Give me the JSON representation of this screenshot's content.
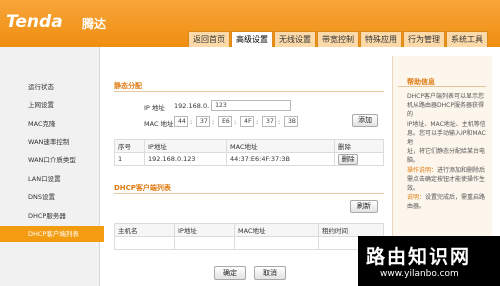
{
  "brand": {
    "logo": "Tenda",
    "logo_cn": "腾达"
  },
  "nav_tabs": [
    "返回首页",
    "高级设置",
    "无线设置",
    "带宽控制",
    "特殊应用",
    "行为管理",
    "系统工具"
  ],
  "sidebar": {
    "items": [
      "运行状态",
      "上网设置",
      "MAC克隆",
      "WAN速率控制",
      "WAN口介质类型",
      "LAN口设置",
      "DNS设置",
      "DHCP服务器",
      "DHCP客户端列表"
    ],
    "active_index": 8
  },
  "static_alloc": {
    "title": "静态分配",
    "ip_label": "IP 地址",
    "ip_prefix": "192.168.0.",
    "ip_last": "123",
    "mac_label": "MAC 地址",
    "mac_octets": [
      "44",
      "37",
      "E6",
      "4F",
      "37",
      "3B"
    ],
    "add_button": "添加"
  },
  "static_table": {
    "headers": [
      "序号",
      "IP地址",
      "MAC地址",
      "删除"
    ],
    "rows": [
      {
        "index": "1",
        "ip": "192.168.0.123",
        "mac": "44:37:E6:4F:37:3B",
        "action": "删除"
      }
    ]
  },
  "client_list": {
    "title": "DHCP客户端列表",
    "refresh_button": "刷新",
    "headers": [
      "主机名",
      "IP地址",
      "MAC地址",
      "租约时间"
    ]
  },
  "footer": {
    "ok": "确定",
    "cancel": "取消"
  },
  "help": {
    "title": "帮助信息",
    "line1": "DHCP客户端列表可以显示您",
    "line2": "机从路由器DHCP服务器获得的",
    "line3": "IP地址、MAC地址、主机等信",
    "line4": "息。您可以手动输入IP和MAC地",
    "line5": "址，将它们静态分配给某台电脑。",
    "op_label": "操作说明：",
    "op_text": "进行添加和删除后需点击确定按钮才能使操作生效。",
    "note_label": "说明：",
    "note_text": "设置完成后，需重启路由器。"
  },
  "watermark": {
    "title": "路由知识网",
    "url": "www.yilanbo.com"
  },
  "colors": {
    "accent": "#f39c12",
    "section_title": "#e07a10"
  }
}
